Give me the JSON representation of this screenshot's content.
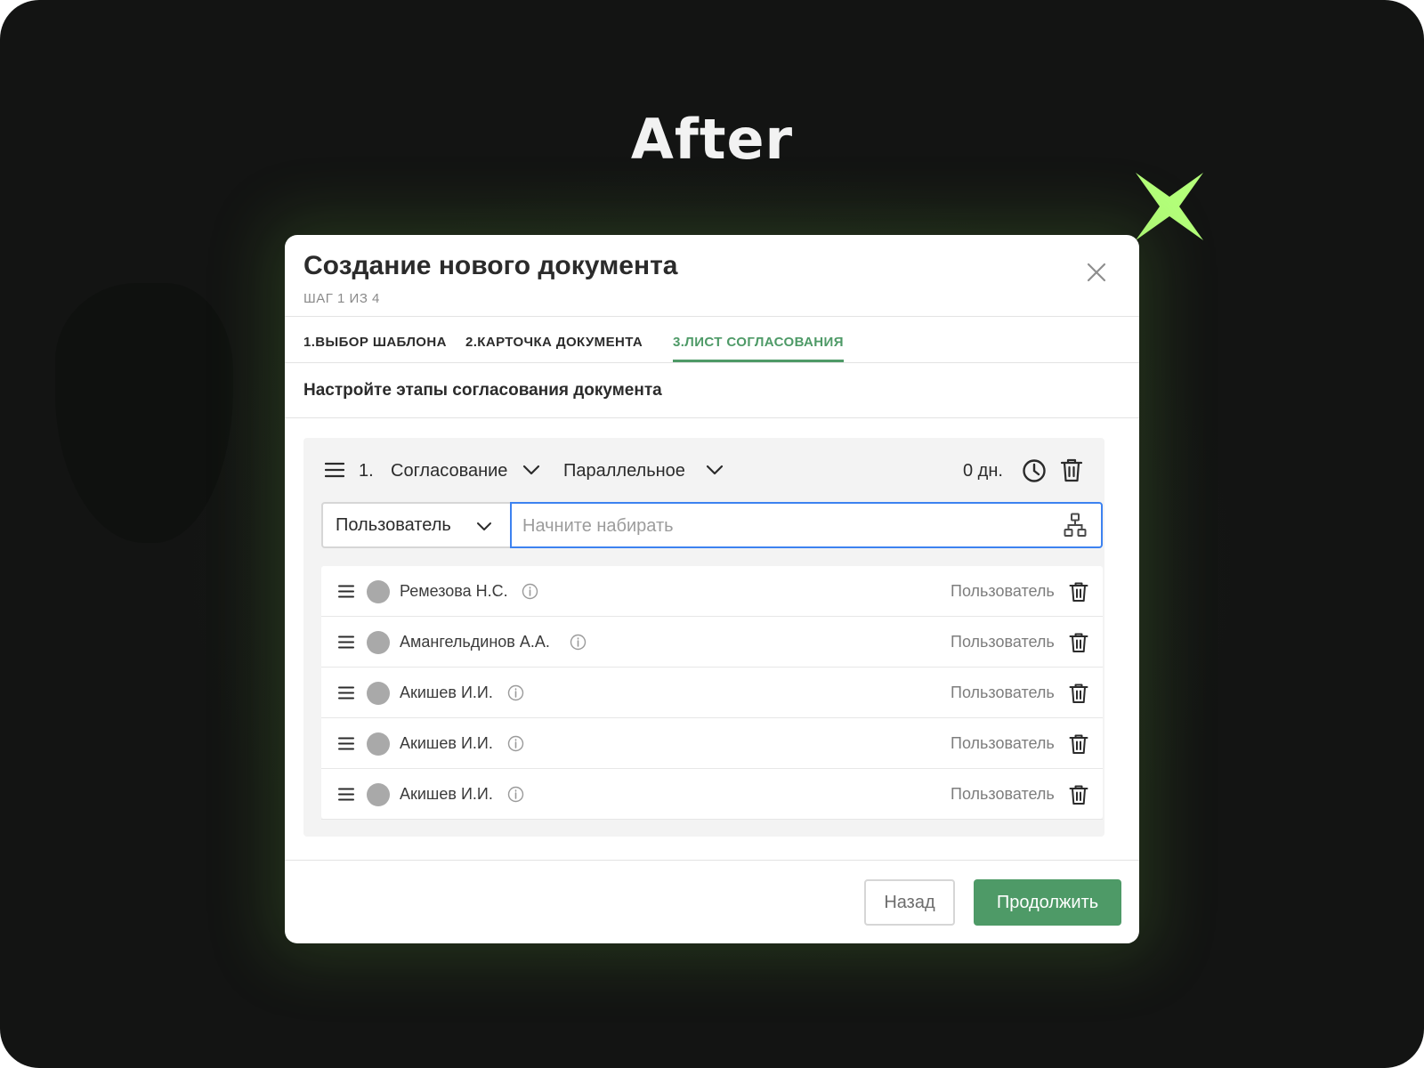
{
  "headline": "After",
  "colors": {
    "accent": "#4e9a67",
    "focus": "#3d82f0",
    "sparkle": "#b4ff7a",
    "background": "#131413"
  },
  "modal": {
    "title": "Создание нового документа",
    "step": "ШАГ 1 ИЗ 4",
    "tabs": [
      {
        "label": "1.ВЫБОР ШАБЛОНА",
        "active": false
      },
      {
        "label": "2.КАРТОЧКА ДОКУМЕНТА",
        "active": false
      },
      {
        "label": "3.ЛИСТ СОГЛАСОВАНИЯ",
        "active": true
      }
    ],
    "section_title": "Настройте этапы согласования документа",
    "stage": {
      "number": "1.",
      "type": "Согласование",
      "mode": "Параллельное",
      "duration": "0 дн.",
      "participant_type": "Пользователь",
      "search_placeholder": "Начните набирать",
      "participants": [
        {
          "name": "Ремезова Н.С.",
          "role": "Пользователь"
        },
        {
          "name": "Амангельдинов А.А.",
          "role": "Пользователь"
        },
        {
          "name": "Акишев И.И.",
          "role": "Пользователь"
        },
        {
          "name": "Акишев И.И.",
          "role": "Пользователь"
        },
        {
          "name": "Акишев И.И.",
          "role": "Пользователь"
        }
      ]
    },
    "footer": {
      "back_label": "Назад",
      "next_label": "Продолжить"
    }
  }
}
